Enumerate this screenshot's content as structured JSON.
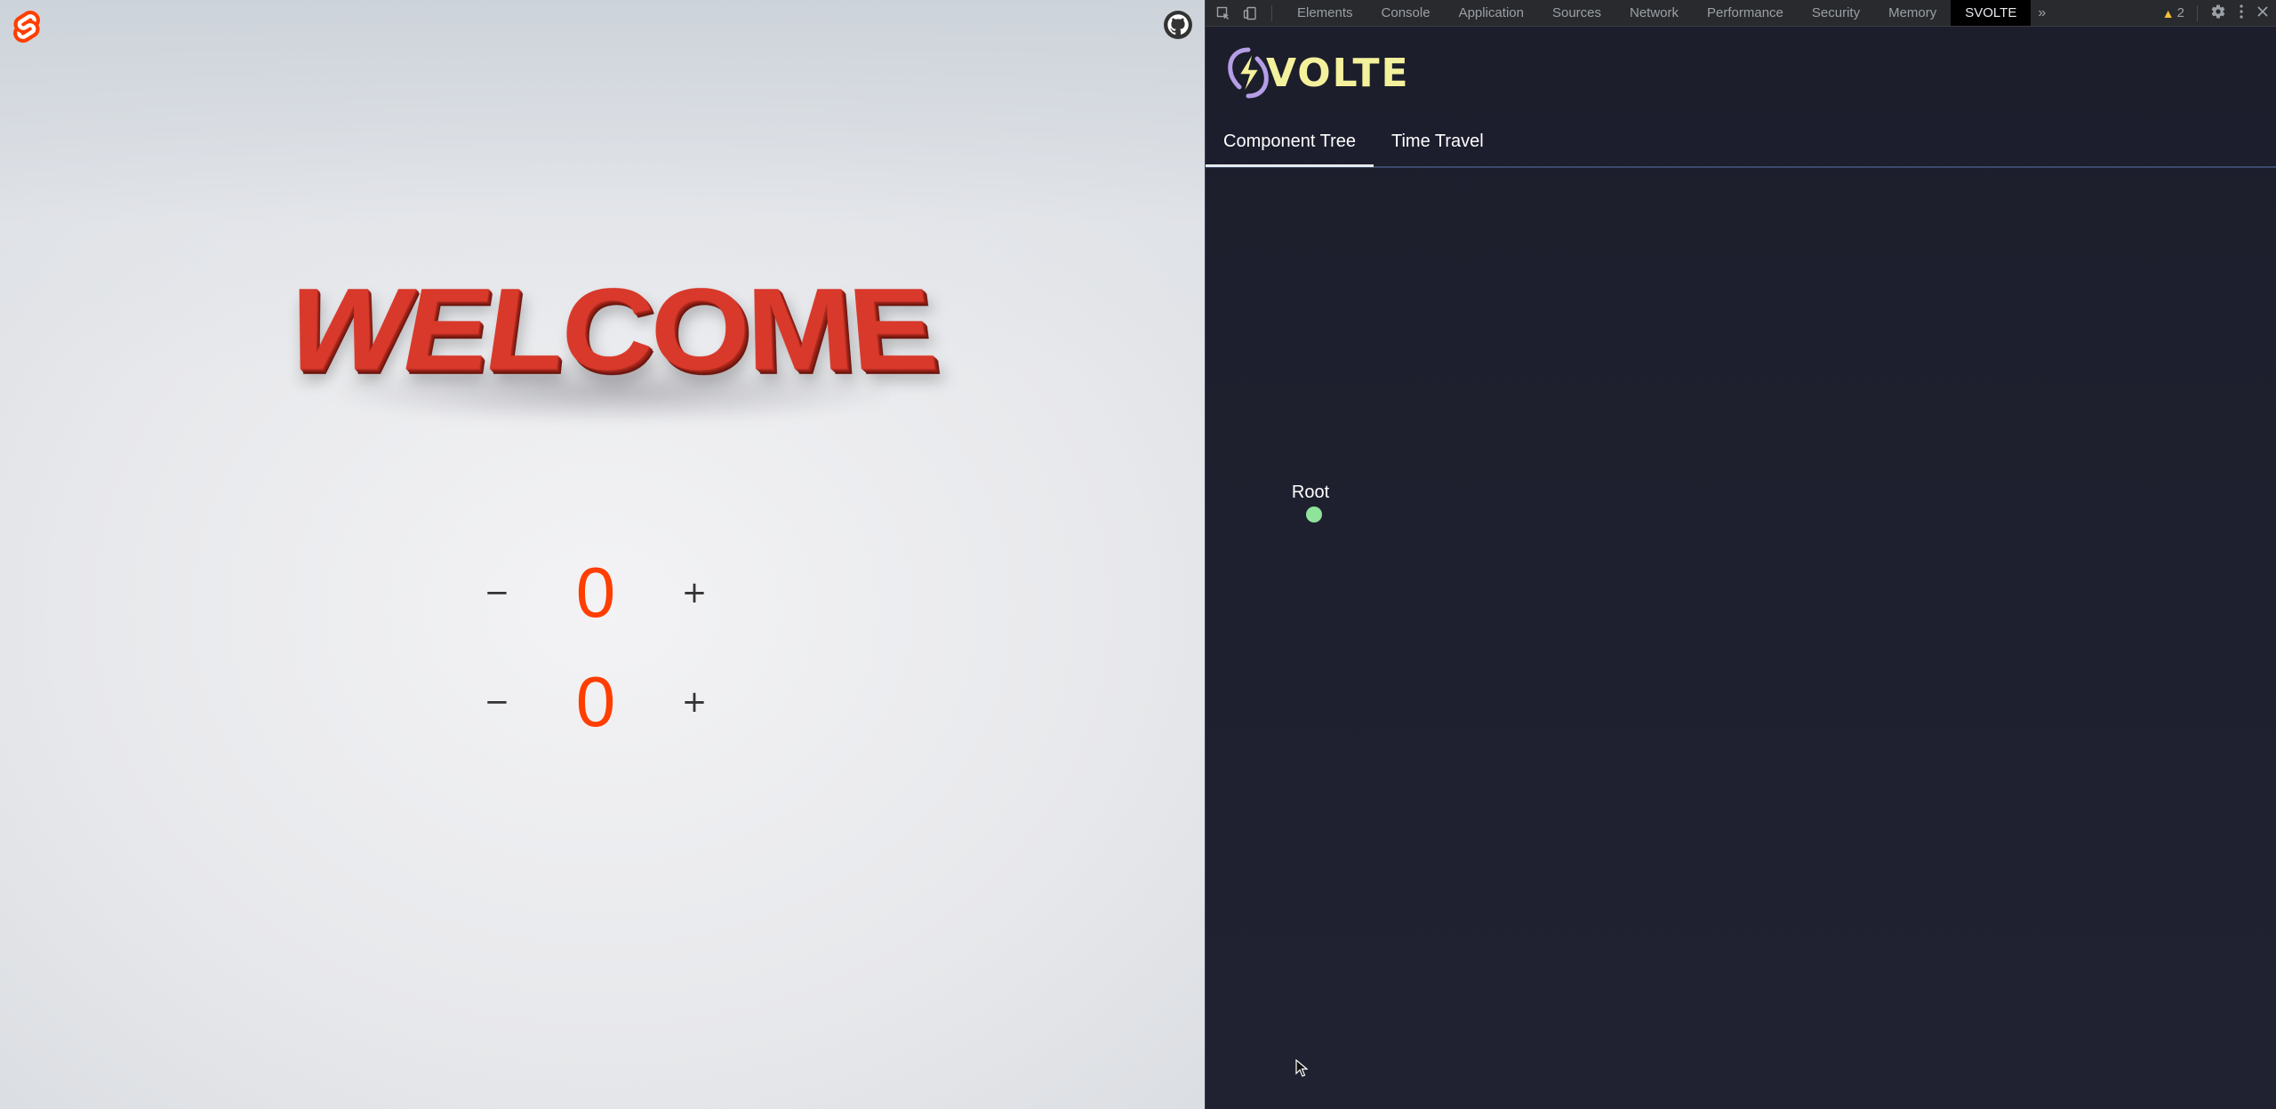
{
  "app": {
    "welcome_text": "WELCOME",
    "counters": [
      {
        "decrement": "−",
        "value": "0",
        "increment": "+"
      },
      {
        "decrement": "−",
        "value": "0",
        "increment": "+"
      }
    ]
  },
  "devtools": {
    "tabs": [
      {
        "label": "Elements"
      },
      {
        "label": "Console"
      },
      {
        "label": "Application"
      },
      {
        "label": "Sources"
      },
      {
        "label": "Network"
      },
      {
        "label": "Performance"
      },
      {
        "label": "Security"
      },
      {
        "label": "Memory"
      },
      {
        "label": "SVOLTE",
        "active": true
      }
    ],
    "more_tabs": "»",
    "warnings_count": "2",
    "svolte": {
      "logo_text": "VOLTE",
      "tabs": [
        {
          "label": "Component Tree",
          "active": true
        },
        {
          "label": "Time Travel"
        }
      ],
      "tree": {
        "root_label": "Root",
        "node_color": "#8fe39a"
      }
    }
  },
  "colors": {
    "svelte_orange": "#ff3e00",
    "welcome_red": "#d8392b",
    "devtools_bg": "#1e2030",
    "svolte_yellow": "#f4f19c"
  },
  "icons": [
    "svelte-logo-icon",
    "github-icon",
    "inspect-element-icon",
    "device-toolbar-icon",
    "warning-icon",
    "settings-gear-icon",
    "kebab-menu-icon",
    "close-icon",
    "svolte-bolt-logo-icon",
    "mouse-cursor-icon"
  ]
}
